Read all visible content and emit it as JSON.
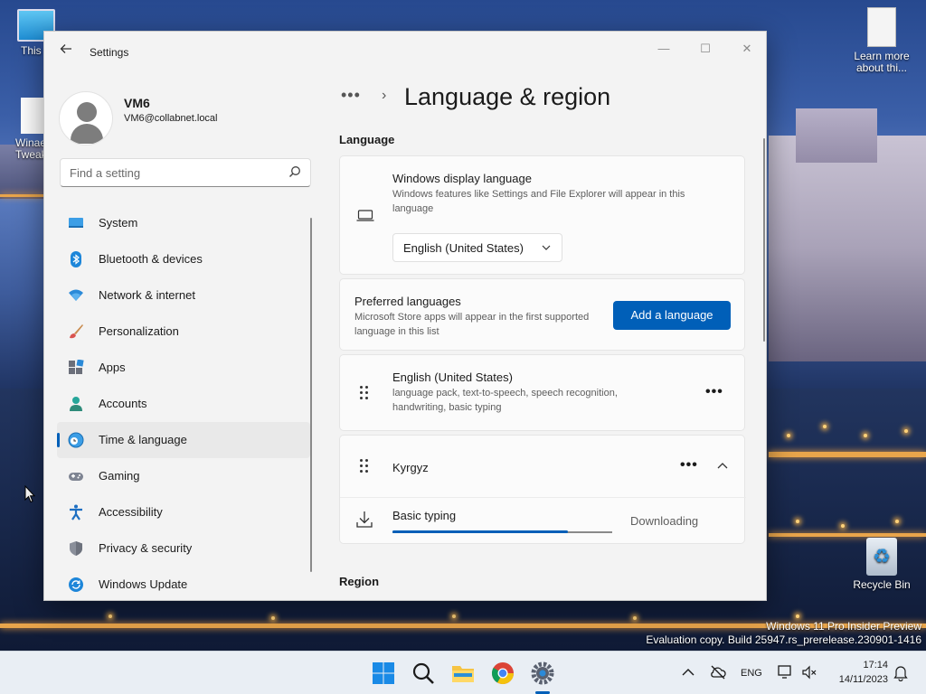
{
  "desktop": {
    "icons": [
      {
        "label": "This PC",
        "label_visible": "This P"
      },
      {
        "label": "Winaero Tweaker",
        "label_visible_1": "Winae",
        "label_visible_2": "Tweak"
      },
      {
        "label": "Learn more about this picture",
        "label_visible_1": "Learn more",
        "label_visible_2": "about thi..."
      },
      {
        "label": "Recycle Bin"
      }
    ],
    "watermark": {
      "line1": "Windows 11 Pro Insider Preview",
      "line2": "Evaluation copy. Build 25947.rs_prerelease.230901-1416"
    }
  },
  "window": {
    "title": "Settings",
    "controls": {
      "minimize": "—",
      "maximize": "☐",
      "close": "✕"
    }
  },
  "profile": {
    "name": "VM6",
    "email": "VM6@collabnet.local"
  },
  "search": {
    "placeholder": "Find a setting"
  },
  "nav": {
    "items": [
      {
        "label": "System",
        "icon": "monitor-icon"
      },
      {
        "label": "Bluetooth & devices",
        "icon": "bluetooth-icon"
      },
      {
        "label": "Network & internet",
        "icon": "wifi-icon"
      },
      {
        "label": "Personalization",
        "icon": "brush-icon"
      },
      {
        "label": "Apps",
        "icon": "apps-icon"
      },
      {
        "label": "Accounts",
        "icon": "person-icon"
      },
      {
        "label": "Time & language",
        "icon": "globe-clock-icon",
        "selected": true
      },
      {
        "label": "Gaming",
        "icon": "gamepad-icon"
      },
      {
        "label": "Accessibility",
        "icon": "accessibility-icon"
      },
      {
        "label": "Privacy & security",
        "icon": "shield-icon"
      },
      {
        "label": "Windows Update",
        "icon": "update-icon"
      }
    ]
  },
  "page": {
    "breadcrumb_more": "•••",
    "breadcrumb_separator": "›",
    "title": "Language & region",
    "language_section": "Language",
    "region_section": "Region",
    "display_language": {
      "title": "Windows display language",
      "description": "Windows features like Settings and File Explorer will appear in this language",
      "selected": "English (United States)"
    },
    "preferred": {
      "title": "Preferred languages",
      "description": "Microsoft Store apps will appear in the first supported language in this list",
      "add_button": "Add a language"
    },
    "languages": [
      {
        "name": "English (United States)",
        "features": "language pack, text-to-speech, speech recognition, handwriting, basic typing",
        "more": "•••"
      },
      {
        "name": "Kyrgyz",
        "more": "•••",
        "expanded": true
      }
    ],
    "download": {
      "feature": "Basic typing",
      "status": "Downloading",
      "progress": 0.8
    }
  },
  "taskbar": {
    "apps": [
      "start-icon",
      "search-icon",
      "file-explorer-icon",
      "chrome-icon",
      "settings-icon"
    ],
    "tray": {
      "language": "ENG",
      "time": "17:14",
      "date": "14/11/2023"
    }
  },
  "colors": {
    "accent": "#005fb8",
    "window_bg": "#f3f3f3",
    "card_bg": "#fbfbfb"
  }
}
